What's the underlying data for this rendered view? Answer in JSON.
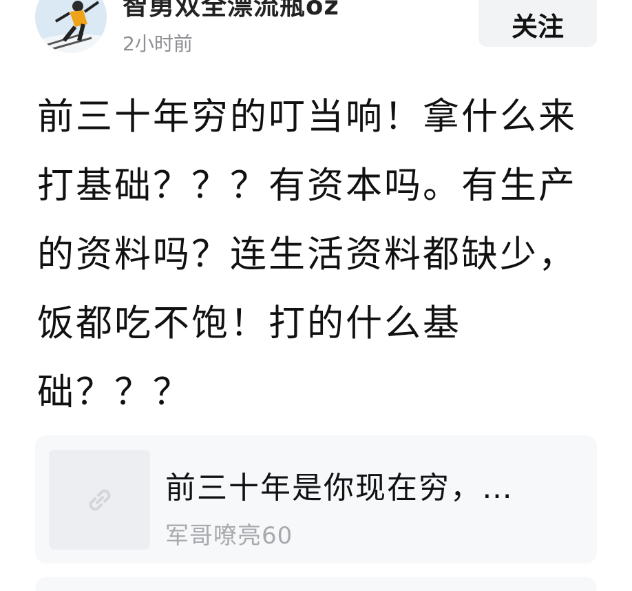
{
  "post": {
    "author_name": "智勇双全漂流瓶oz",
    "timestamp": "2小时前",
    "follow_label": "关注",
    "content": "前三十年穷的叮当响！拿什么来打基础？？？有资本吗。有生产的资料吗？连生活资料都缺少，饭都吃不饱！打的什么基础？？？"
  },
  "link_card": {
    "title": "前三十年是你现在穷，…",
    "source": "军哥嘹亮60",
    "thumb_icon": "link-icon"
  },
  "colors": {
    "background": "#ffffff",
    "card_background": "#f7f8fa",
    "secondary_text": "#8e8e93",
    "button_background": "#f2f3f5"
  }
}
